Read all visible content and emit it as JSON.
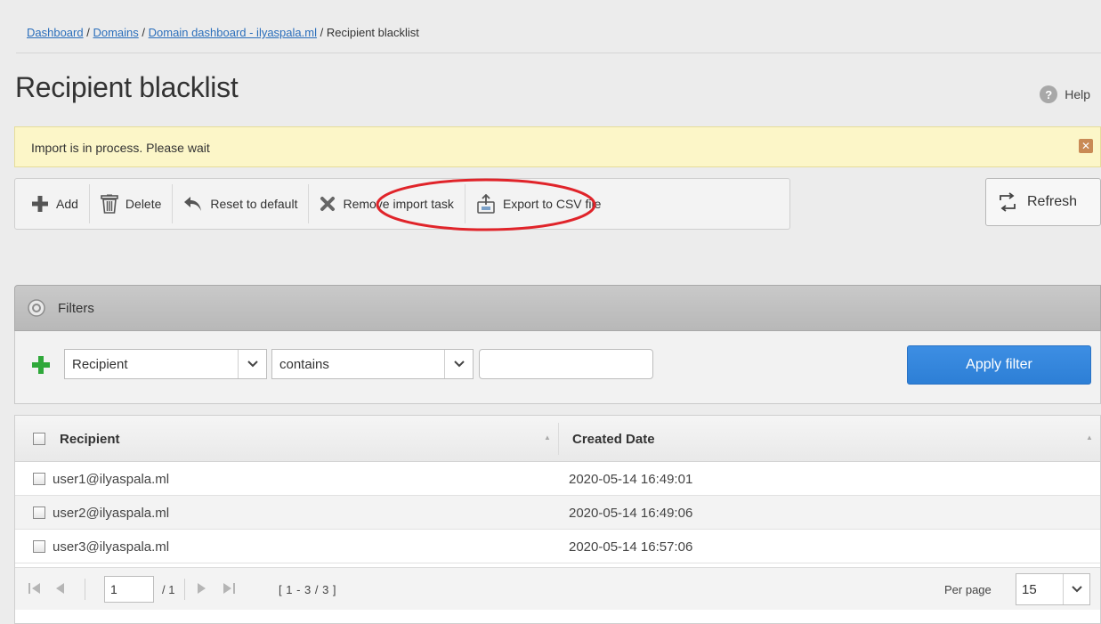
{
  "breadcrumb": {
    "items": [
      "Dashboard",
      "Domains",
      "Domain dashboard - ilyaspala.ml"
    ],
    "current": "Recipient blacklist",
    "separator": "/"
  },
  "page": {
    "title": "Recipient blacklist",
    "help_label": "Help"
  },
  "notice": {
    "text": "Import is in process. Please wait",
    "close_glyph": "✕"
  },
  "toolbar": {
    "add": "Add",
    "delete": "Delete",
    "reset": "Reset to default",
    "remove_import": "Remove import task",
    "export": "Export to CSV file",
    "refresh": "Refresh"
  },
  "filters": {
    "title": "Filters",
    "field_selected": "Recipient",
    "operator_selected": "contains",
    "value": "",
    "apply_label": "Apply filter"
  },
  "table": {
    "columns": [
      "Recipient",
      "Created Date"
    ],
    "rows": [
      {
        "recipient": "user1@ilyaspala.ml",
        "created": "2020-05-14 16:49:01"
      },
      {
        "recipient": "user2@ilyaspala.ml",
        "created": "2020-05-14 16:49:06"
      },
      {
        "recipient": "user3@ilyaspala.ml",
        "created": "2020-05-14 16:57:06"
      }
    ]
  },
  "pager": {
    "page": "1",
    "total_pages": "/ 1",
    "range": "[ 1 - 3 / 3 ]",
    "per_page_label": "Per page",
    "per_page_value": "15"
  },
  "colors": {
    "link": "#2a6ebb",
    "notice_bg": "#fcf6c8",
    "apply_button": "#3189e0",
    "highlight_ellipse": "#e0242a",
    "add_icon": "#2fa83a"
  }
}
